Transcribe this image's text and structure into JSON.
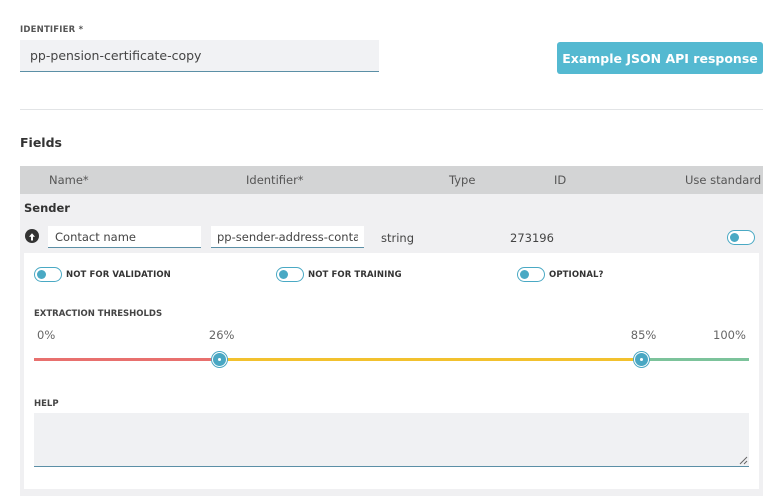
{
  "identifier": {
    "label": "IDENTIFIER *",
    "value": "pp-pension-certificate-copy"
  },
  "json_button_label": "Example JSON API response",
  "fields_title": "Fields",
  "table": {
    "headers": [
      "Name*",
      "Identifier*",
      "Type",
      "ID",
      "Use standard"
    ],
    "group": "Sender",
    "row": {
      "name_value": "Contact name",
      "identifier_value": "pp-sender-address-conta",
      "type": "string",
      "id": "273196",
      "use_standard": false
    }
  },
  "options": [
    {
      "label": "NOT FOR VALIDATION",
      "enabled": false
    },
    {
      "label": "NOT FOR TRAINING",
      "enabled": false
    },
    {
      "label": "OPTIONAL?",
      "enabled": false
    }
  ],
  "thresholds": {
    "title": "EXTRACTION THRESHOLDS",
    "min_label": "0%",
    "low_label": "26%",
    "high_label": "85%",
    "max_label": "100%",
    "low_value": 26,
    "high_value": 85,
    "colors": {
      "low": "#e8706e",
      "mid": "#f2c12e",
      "high": "#7cc39b",
      "handle": "#49a7c3"
    }
  },
  "help": {
    "label": "HELP",
    "value": ""
  },
  "colors": {
    "accent": "#54b9d1",
    "toggle": "#4aa9c4",
    "header_bg": "#d3d4d5"
  }
}
